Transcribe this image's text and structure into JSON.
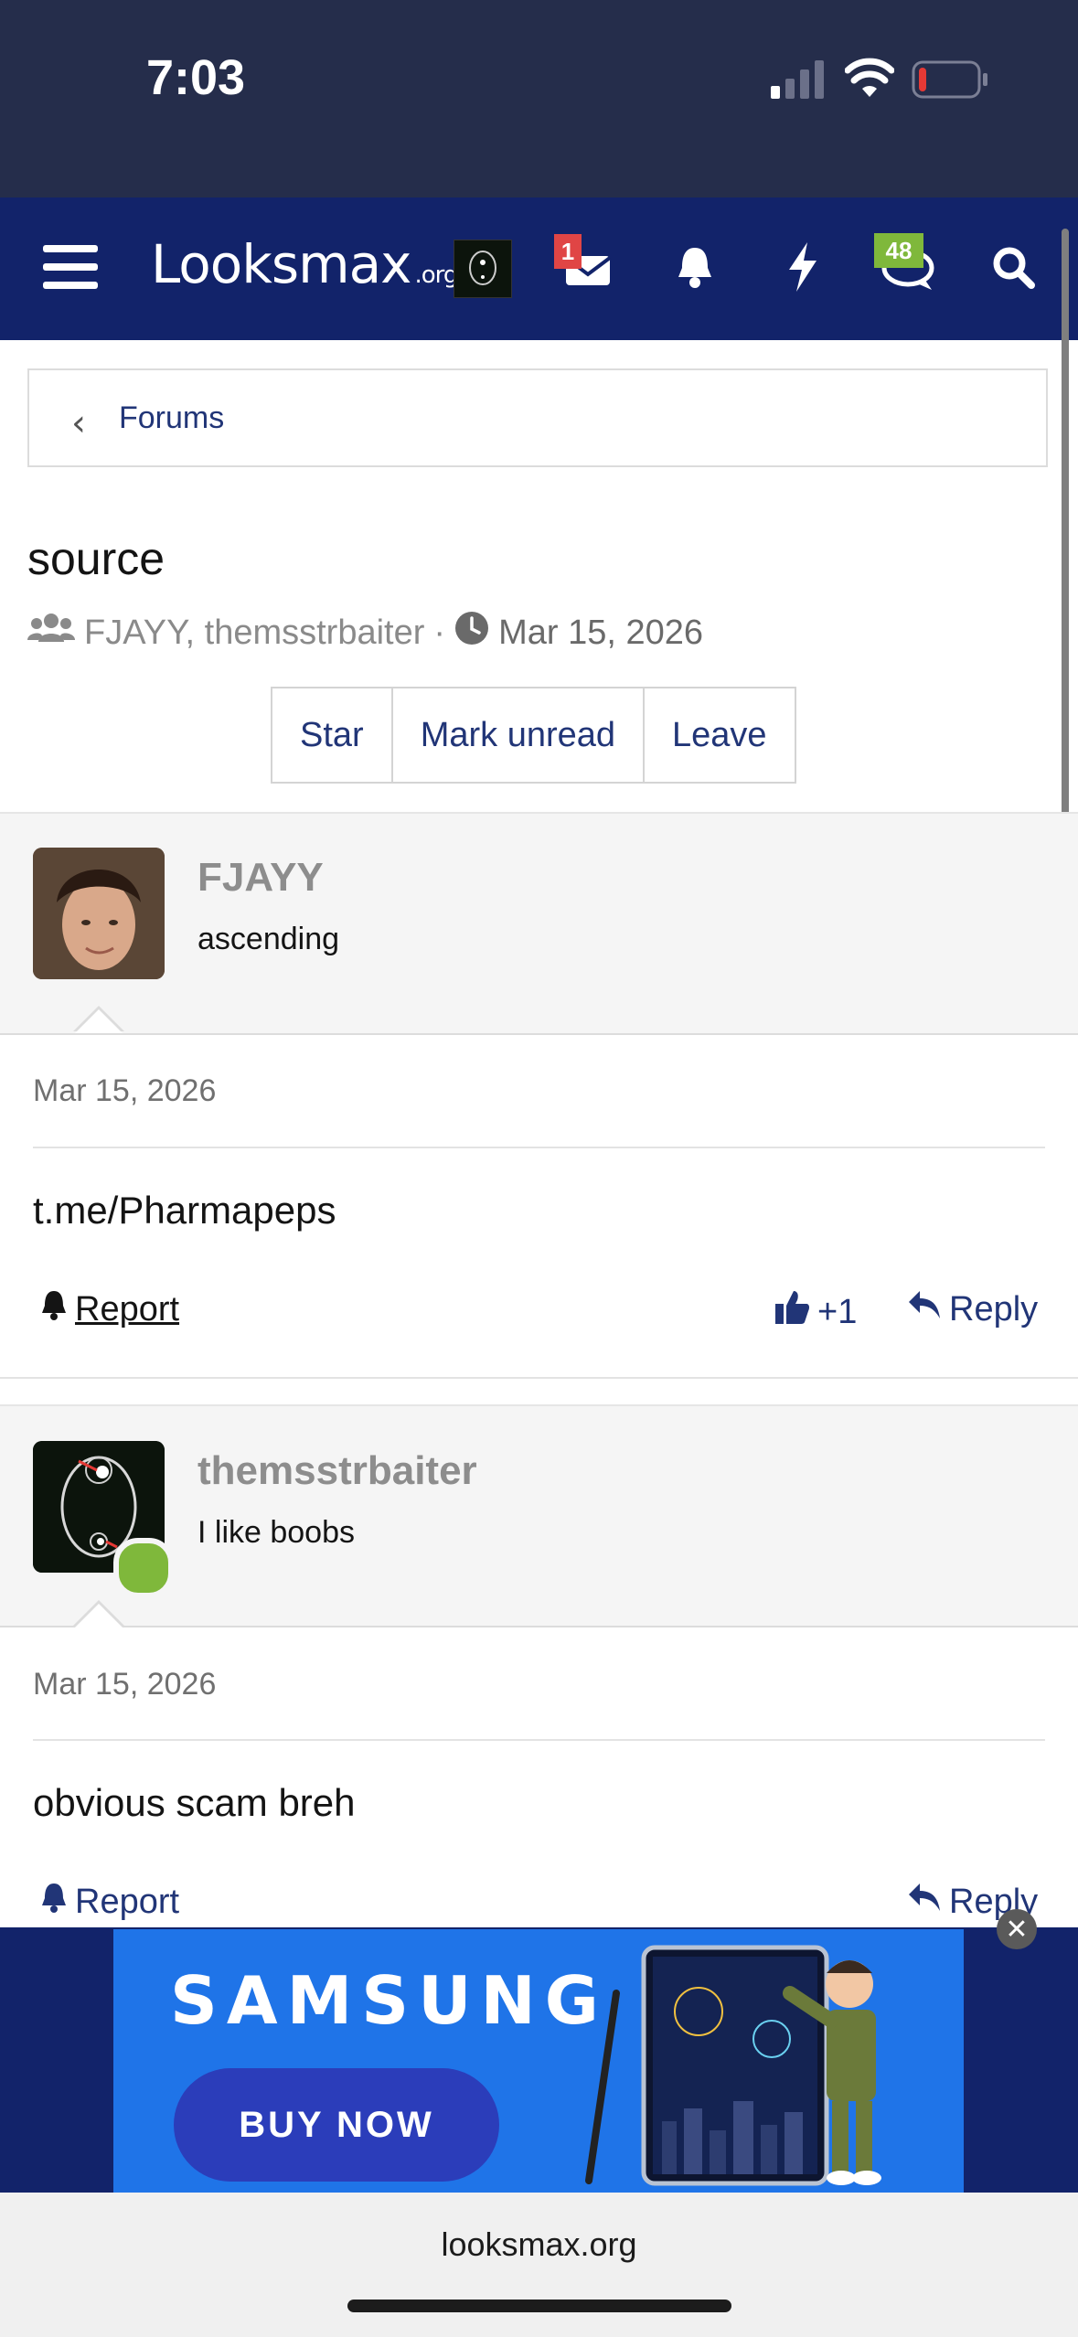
{
  "status_bar": {
    "time": "7:03"
  },
  "nav": {
    "logo_main": "Looksmax",
    "logo_suffix": ".org",
    "inbox_badge": "1",
    "chat_badge": "48"
  },
  "breadcrumb": {
    "label": "Forums"
  },
  "thread": {
    "title": "source",
    "participants": "FJAYY, themsstrbaiter",
    "separator": "·",
    "date": "Mar 15, 2026",
    "buttons": {
      "star": "Star",
      "mark_unread": "Mark unread",
      "leave": "Leave"
    }
  },
  "messages": [
    {
      "username": "FJAYY",
      "user_title": "ascending",
      "date": "Mar 15, 2026",
      "body": "t.me/Pharmapeps",
      "report_label": "Report",
      "reaction_count": "+1",
      "reply_label": "Reply"
    },
    {
      "username": "themsstrbaiter",
      "user_title": "I like boobs",
      "date": "Mar 15, 2026",
      "body": "obvious scam breh",
      "report_label": "Report",
      "reply_label": "Reply"
    }
  ],
  "ad": {
    "brand": "SAMSUNG",
    "cta": "BUY NOW"
  },
  "browser": {
    "url": "looksmax.org"
  },
  "colors": {
    "nav_bg": "#12236a",
    "status_bg": "#252d4b",
    "link": "#213577",
    "online": "#7fb83b",
    "badge_red": "#e04545",
    "badge_green": "#7fb83b"
  }
}
